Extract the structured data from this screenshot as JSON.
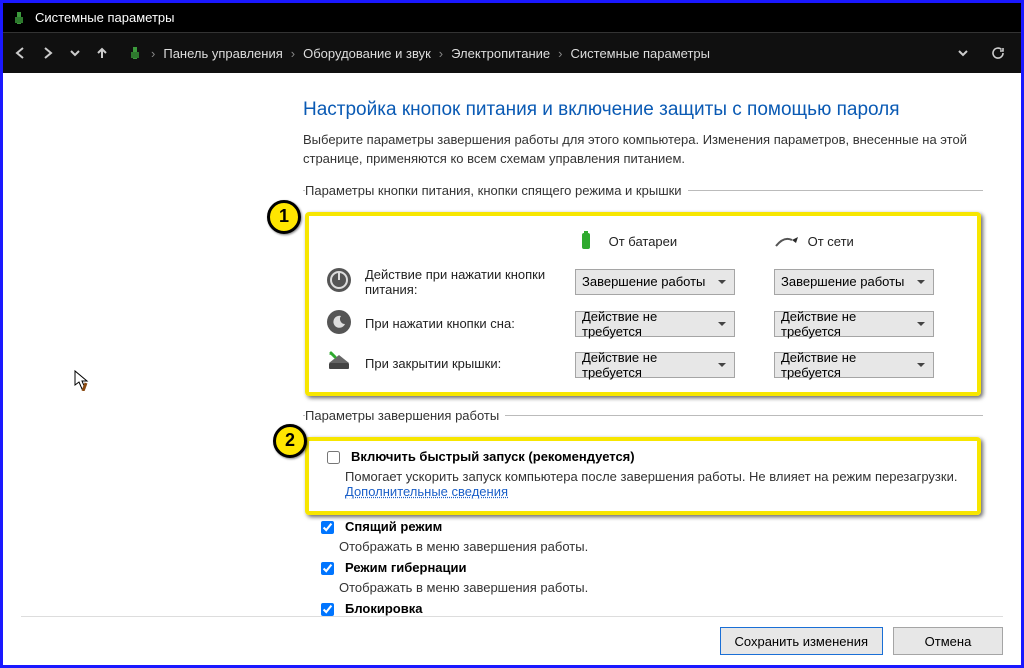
{
  "window": {
    "title": "Системные параметры"
  },
  "breadcrumb": {
    "root": "Панель управления",
    "lvl2": "Оборудование и звук",
    "lvl3": "Электропитание",
    "lvl4": "Системные параметры"
  },
  "page": {
    "title": "Настройка кнопок питания и включение защиты с помощью пароля",
    "desc": "Выберите параметры завершения работы для этого компьютера. Изменения параметров, внесенные на этой странице, применяются ко всем схемам управления питанием."
  },
  "section1": {
    "legend": "Параметры кнопки питания, кнопки спящего режима и крышки",
    "badge": "1",
    "col_battery": "От батареи",
    "col_ac": "От сети",
    "rows": {
      "power": {
        "label": "Действие при нажатии кнопки питания:",
        "battery": "Завершение работы",
        "ac": "Завершение работы"
      },
      "sleep": {
        "label": "При нажатии кнопки сна:",
        "battery": "Действие не требуется",
        "ac": "Действие не требуется"
      },
      "lid": {
        "label": "При закрытии крышки:",
        "battery": "Действие не требуется",
        "ac": "Действие не требуется"
      }
    }
  },
  "section2": {
    "legend": "Параметры завершения работы",
    "badge": "2",
    "fastboot": {
      "label": "Включить быстрый запуск (рекомендуется)",
      "sub1": "Помогает ускорить запуск компьютера после завершения работы. Не влияет на режим перезагрузки. ",
      "link": "Дополнительные сведения"
    },
    "sleep": {
      "label": "Спящий режим",
      "sub": "Отображать в меню завершения работы."
    },
    "hibernate": {
      "label": "Режим гибернации",
      "sub": "Отображать в меню завершения работы."
    },
    "lock": {
      "label": "Блокировка"
    }
  },
  "footer": {
    "save": "Сохранить изменения",
    "cancel": "Отмена"
  }
}
